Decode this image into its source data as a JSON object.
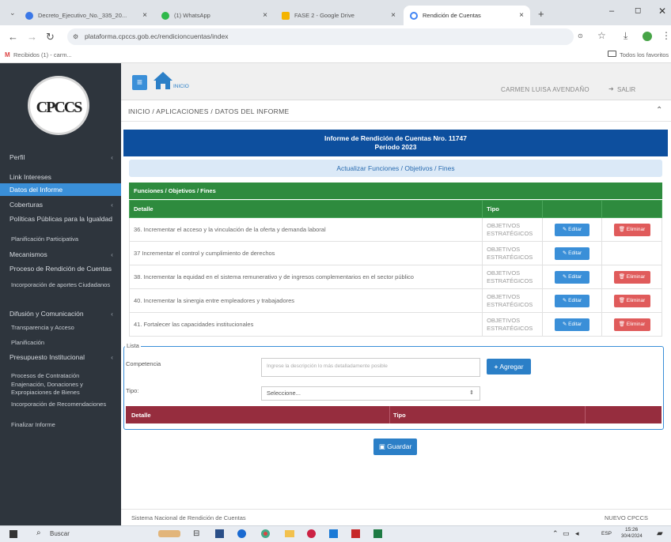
{
  "browser": {
    "tabs": [
      {
        "title": "Decreto_Ejecutivo_No._335_20...",
        "icon": "chrome-icon"
      },
      {
        "title": "(1) WhatsApp",
        "icon": "whatsapp-icon"
      },
      {
        "title": "FASE 2 - Google Drive",
        "icon": "drive-icon"
      },
      {
        "title": "Rendición de Cuentas",
        "icon": "google-icon"
      }
    ],
    "new_tab": "+",
    "url": "plataforma.cpccs.gob.ec/rendicioncuentas/index",
    "bookmarks": {
      "left": "Recibidos (1) - carm...",
      "right": "Todos los favoritos"
    }
  },
  "topbar": {
    "home_label": "INICIO",
    "user": "CARMEN LUISA AVENDAÑO",
    "logout": "SALIR"
  },
  "breadcrumb": "INICIO / APLICACIONES / DATOS DEL INFORME",
  "sidebar": {
    "logo_text": "CPCCS",
    "items": [
      {
        "label": "Perfil",
        "type": "main"
      },
      {
        "label": "Link Intereses",
        "type": "main"
      },
      {
        "label": "Datos del Informe",
        "type": "active"
      },
      {
        "label": "Coberturas",
        "type": "main"
      },
      {
        "label": "Políticas Públicas para la Igualdad",
        "type": "main"
      },
      {
        "label": "Planificación Participativa",
        "type": "sub"
      },
      {
        "label": "Mecanismos",
        "type": "main"
      },
      {
        "label": "Proceso de Rendición de Cuentas",
        "type": "main"
      },
      {
        "label": "Incorporación de aportes Ciudadanos",
        "type": "sub"
      },
      {
        "label": "Difusión y Comunicación",
        "type": "main"
      },
      {
        "label": "Transparencia y Acceso",
        "type": "sub"
      },
      {
        "label": "Planificación",
        "type": "sub"
      },
      {
        "label": "Presupuesto Institucional",
        "type": "main"
      },
      {
        "label": "Procesos de Contratación",
        "type": "sub"
      },
      {
        "label": "Enajenación, Donaciones y Expropiaciones de Bienes",
        "type": "sub"
      },
      {
        "label": "Incorporación de Recomendaciones",
        "type": "sub"
      },
      {
        "label": "Finalizar Informe",
        "type": "sub"
      }
    ]
  },
  "report": {
    "title": "Informe de Rendición de Cuentas Nro. 11747",
    "period": "Periodo 2023",
    "update_bar": "Actualizar Funciones / Objetivos / Fines"
  },
  "functions_table": {
    "section_title": "Funciones / Objetivos / Fines",
    "headers": [
      "Detalle",
      "Tipo",
      "",
      ""
    ],
    "rows": [
      {
        "detalle": "36. Incrementar el acceso y la vinculación de la oferta y demanda laboral",
        "tipo": "OBJETIVOS ESTRATÉGICOS",
        "edit": "Editar",
        "del": "Eliminar"
      },
      {
        "detalle": "37 Incrementar el control y cumplimiento de derechos",
        "tipo": "OBJETIVOS ESTRATÉGICOS",
        "edit": "Editar",
        "del": ""
      },
      {
        "detalle": "38. Incrementar la equidad en el sistema remunerativo y de ingresos complementarios en el sector público",
        "tipo": "OBJETIVOS ESTRATÉGICOS",
        "edit": "Editar",
        "del": "Eliminar"
      },
      {
        "detalle": "40. Incrementar la sinergia entre empleadores y trabajadores",
        "tipo": "OBJETIVOS ESTRATÉGICOS",
        "edit": "Editar",
        "del": "Eliminar"
      },
      {
        "detalle": "41. Fortalecer las capacidades institucionales",
        "tipo": "OBJETIVOS ESTRATÉGICOS",
        "edit": "Editar",
        "del": "Eliminar"
      }
    ]
  },
  "form": {
    "legend": "Lista",
    "competencia_label": "Competencia",
    "competencia_placeholder": "Ingrese la descripción lo más detalladamente posible",
    "add_button": "Agregar",
    "tipo_label": "Tipo:",
    "tipo_value": "Seleccione...",
    "headers": [
      "Detalle",
      "Tipo"
    ]
  },
  "save_button": "Guardar",
  "footer": {
    "left": "Sistema Nacional de Rendición de Cuentas",
    "right": "NUEVO CPCCS"
  },
  "taskbar": {
    "search": "Buscar",
    "lang": "ESP",
    "time": "15:26",
    "date": "30/4/2024"
  },
  "colors": {
    "primary": "#3a8fd8",
    "header_blue": "#0d4f9e",
    "green": "#2e8b3e",
    "maroon": "#962d3e",
    "sidebar": "#2e353d"
  }
}
